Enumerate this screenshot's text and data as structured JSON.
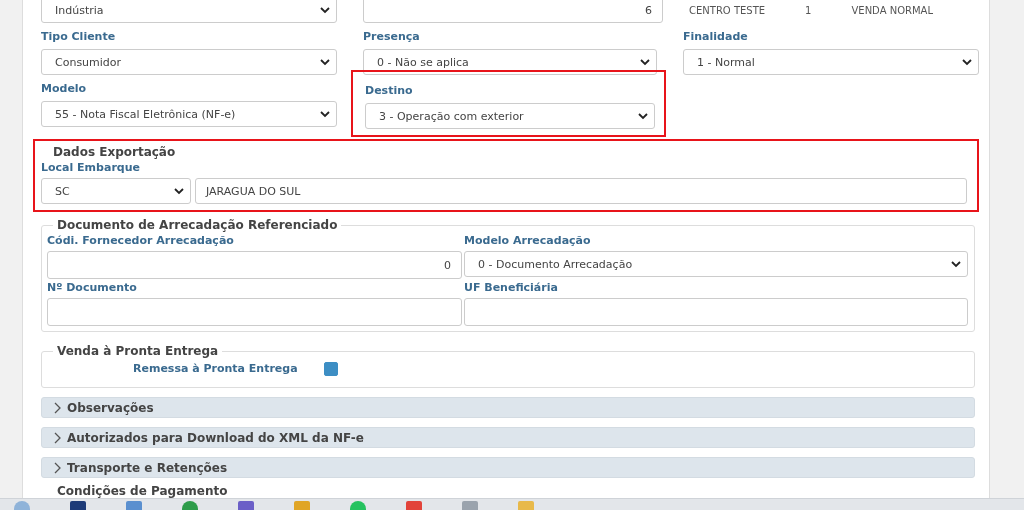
{
  "top_row": {
    "select_value": "Indústria",
    "number_value": "6",
    "company": "CENTRO TESTE",
    "code": "1",
    "operation": "VENDA NORMAL"
  },
  "fields_rows": [
    [
      {
        "label": "Tipo Cliente",
        "value": "Consumidor",
        "highlighted": false
      },
      {
        "label": "Presença",
        "value": "0 - Não se aplica",
        "highlighted": false
      },
      {
        "label": "Finalidade",
        "value": "1 - Normal",
        "highlighted": false
      }
    ],
    [
      {
        "label": "Modelo",
        "value": "55 - Nota Fiscal Eletrônica (NF-e)",
        "highlighted": false
      },
      {
        "label": "Destino",
        "value": "3 - Operação com exterior",
        "highlighted": true
      }
    ]
  ],
  "export_section": {
    "title": "Dados Exportação",
    "highlighted": true,
    "label": "Local Embarque",
    "state": "SC",
    "place": "JARAGUA DO SUL"
  },
  "document_section": {
    "title": "Documento de Arrecadação Referenciado",
    "fields": [
      {
        "kind": "number",
        "label": "Códi. Fornecedor Arrecadação",
        "value": "0"
      },
      {
        "kind": "select",
        "label": "Modelo Arrecadação",
        "value": "0 - Documento Arrecadação"
      },
      {
        "kind": "text",
        "label": "Nº Documento"
      },
      {
        "kind": "text",
        "label": "UF Beneficiária"
      }
    ]
  },
  "delivery_section": {
    "title": "Venda à Pronta Entrega",
    "label": "Remessa à Pronta Entrega",
    "checked": true
  },
  "accordions": [
    {
      "title": "Observações",
      "expanded": false
    },
    {
      "title": "Autorizados para Download do XML da NF-e",
      "expanded": false
    },
    {
      "title": "Transporte e Retenções",
      "expanded": false
    }
  ],
  "cut_section": {
    "title": "Condições de Pagamento"
  }
}
